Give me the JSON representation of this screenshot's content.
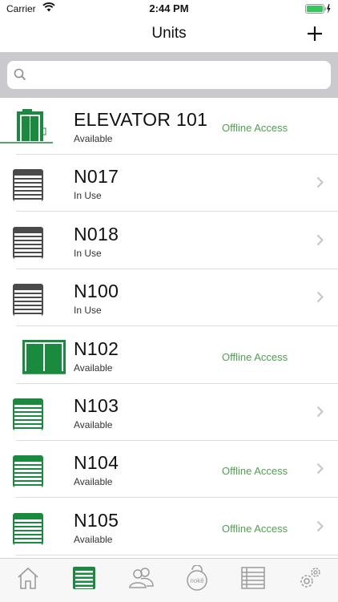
{
  "status_bar": {
    "carrier": "Carrier",
    "time": "2:44 PM"
  },
  "nav": {
    "title": "Units",
    "add_icon": "plus-icon"
  },
  "search": {
    "value": "",
    "placeholder": ""
  },
  "colors": {
    "accent_green": "#1a8a3f",
    "available_text": "#4fa14f",
    "in_use_gray": "#4a4a4a"
  },
  "units": [
    {
      "name": "ELEVATOR 101",
      "status": "Available",
      "access": "Offline Access",
      "icon": "elevator-icon",
      "chevron": false
    },
    {
      "name": "N017",
      "status": "In Use",
      "access": "",
      "icon": "storage-door-icon",
      "chevron": true
    },
    {
      "name": "N018",
      "status": "In Use",
      "access": "",
      "icon": "storage-door-icon",
      "chevron": true
    },
    {
      "name": "N100",
      "status": "In Use",
      "access": "",
      "icon": "storage-door-icon",
      "chevron": true
    },
    {
      "name": "N102",
      "status": "Available",
      "access": "Offline Access",
      "icon": "double-door-icon",
      "chevron": false
    },
    {
      "name": "N103",
      "status": "Available",
      "access": "",
      "icon": "storage-door-icon",
      "chevron": true
    },
    {
      "name": "N104",
      "status": "Available",
      "access": "Offline Access",
      "icon": "storage-door-icon",
      "chevron": true
    },
    {
      "name": "N105",
      "status": "Available",
      "access": "Offline Access",
      "icon": "storage-door-icon",
      "chevron": true
    }
  ],
  "tabs": [
    {
      "icon": "home-icon"
    },
    {
      "icon": "units-icon",
      "selected": true
    },
    {
      "icon": "users-icon"
    },
    {
      "icon": "noke-lock-icon",
      "label": "nokē"
    },
    {
      "icon": "list-icon"
    },
    {
      "icon": "settings-icon"
    }
  ]
}
